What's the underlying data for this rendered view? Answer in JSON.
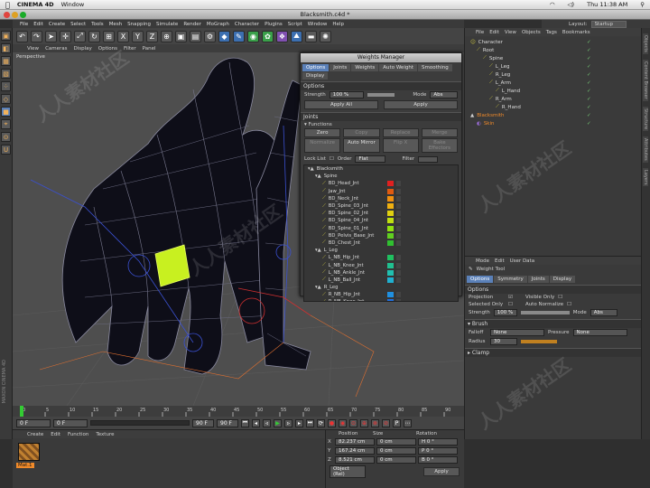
{
  "mac_menubar": {
    "app": "CINEMA 4D",
    "menu": "Window",
    "clock": "Thu 11:38 AM"
  },
  "window": {
    "title": "Blacksmith.c4d *"
  },
  "main_menu": [
    "File",
    "Edit",
    "Create",
    "Select",
    "Tools",
    "Mesh",
    "Snapping",
    "Simulate",
    "Render",
    "MoGraph",
    "Character",
    "Plugins",
    "Script",
    "Window",
    "Help"
  ],
  "layout": {
    "label": "Layout:",
    "value": "Startup"
  },
  "viewport": {
    "menu": [
      "View",
      "Cameras",
      "Display",
      "Options",
      "Filter",
      "Panel"
    ],
    "camera_label": "Perspective"
  },
  "weights_manager": {
    "title": "Weights Manager",
    "tabs": [
      "Options",
      "Joints",
      "Weights",
      "Auto Weight",
      "Smoothing",
      "Display"
    ],
    "options_label": "Options",
    "strength_label": "Strength",
    "strength_value": "100 %",
    "mode_label": "Mode",
    "mode_value": "Abs",
    "apply_all": "Apply All",
    "apply": "Apply",
    "joints_label": "Joints",
    "functions_label": "Functions",
    "function_buttons": [
      "Zero",
      "Copy",
      "Replace",
      "Merge",
      "Normalize",
      "Auto Mirror",
      "Flip X",
      "Bake Effectors"
    ],
    "locklist_label": "Lock List",
    "order_label": "Order",
    "order_value": "Flat",
    "filter_label": "Filter",
    "joints": [
      {
        "name": "Blacksmith",
        "indent": 0,
        "color": ""
      },
      {
        "name": "Spine",
        "indent": 1,
        "color": ""
      },
      {
        "name": "BD_Head_Jnt",
        "indent": 2,
        "color": "#e02020"
      },
      {
        "name": "Jaw_Jnt",
        "indent": 2,
        "color": "#e05a10"
      },
      {
        "name": "BD_Neck_Jnt",
        "indent": 2,
        "color": "#f09010"
      },
      {
        "name": "BD_Spine_03_Jnt",
        "indent": 2,
        "color": "#f0b010"
      },
      {
        "name": "BD_Spine_02_Jnt",
        "indent": 2,
        "color": "#e0d010"
      },
      {
        "name": "BD_Spine_04_Jnt",
        "indent": 2,
        "color": "#c0e010"
      },
      {
        "name": "BD_Spine_01_Jnt",
        "indent": 2,
        "color": "#90e010"
      },
      {
        "name": "BD_Pelvis_Base_Jnt",
        "indent": 2,
        "color": "#60d020"
      },
      {
        "name": "BD_Chest_Jnt",
        "indent": 2,
        "color": "#30c030"
      },
      {
        "name": "L_Leg",
        "indent": 1,
        "color": ""
      },
      {
        "name": "L_NB_Hip_Jnt",
        "indent": 2,
        "color": "#20c060"
      },
      {
        "name": "L_NB_Knee_Jnt",
        "indent": 2,
        "color": "#20c090"
      },
      {
        "name": "L_NB_Ankle_Jnt",
        "indent": 2,
        "color": "#20c0b0"
      },
      {
        "name": "L_NB_Ball_Jnt",
        "indent": 2,
        "color": "#20b0d0"
      },
      {
        "name": "R_Leg",
        "indent": 1,
        "color": ""
      },
      {
        "name": "R_NB_Hip_Jnt",
        "indent": 2,
        "color": "#2090e0"
      },
      {
        "name": "R_NB_Knee_Jnt",
        "indent": 2,
        "color": "#2070e0"
      }
    ]
  },
  "object_manager": {
    "menu": [
      "File",
      "Edit",
      "View",
      "Objects",
      "Tags",
      "Bookmarks"
    ],
    "objects": [
      {
        "name": "Character",
        "indent": 0,
        "selected": false
      },
      {
        "name": "Root",
        "indent": 1,
        "selected": false
      },
      {
        "name": "Spine",
        "indent": 2,
        "selected": false
      },
      {
        "name": "L_Leg",
        "indent": 3,
        "selected": false
      },
      {
        "name": "R_Leg",
        "indent": 3,
        "selected": false
      },
      {
        "name": "L_Arm",
        "indent": 3,
        "selected": false
      },
      {
        "name": "L_Hand",
        "indent": 4,
        "selected": false
      },
      {
        "name": "R_Arm",
        "indent": 3,
        "selected": false
      },
      {
        "name": "R_Hand",
        "indent": 4,
        "selected": false
      },
      {
        "name": "Blacksmith",
        "indent": 0,
        "selected": true
      },
      {
        "name": "Skin",
        "indent": 1,
        "selected": true
      }
    ]
  },
  "attribute_manager": {
    "menu": [
      "Mode",
      "Edit",
      "User Data"
    ],
    "tool_name": "Weight Tool",
    "tabs": [
      "Options",
      "Symmetry",
      "Joints",
      "Display"
    ],
    "options_label": "Options",
    "projection_label": "Projection",
    "visible_only_label": "Visible Only",
    "selected_only_label": "Selected Only",
    "auto_normalize_label": "Auto Normalize",
    "strength_label": "Strength",
    "strength_value": "100 %",
    "mode_label": "Mode",
    "mode_value": "Abs",
    "brush_label": "Brush",
    "falloff_label": "Falloff",
    "falloff_value": "None",
    "pressure_label": "Pressure",
    "pressure_value": "None",
    "radius_label": "Radius",
    "radius_value": "30",
    "clamp_label": "Clamp"
  },
  "timeline": {
    "ticks": [
      "0",
      "5",
      "10",
      "15",
      "20",
      "25",
      "30",
      "35",
      "40",
      "45",
      "50",
      "55",
      "60",
      "65",
      "70",
      "75",
      "80",
      "85",
      "90"
    ],
    "frame_start": "0 F",
    "frame_current": "0 F",
    "frame_end": "90 F",
    "frame_max": "90 F",
    "frame_right": "0 F"
  },
  "material_manager": {
    "menu": [
      "Create",
      "Edit",
      "Function",
      "Texture"
    ],
    "material_name": "Mat.1"
  },
  "coordinates": {
    "headers": [
      "Position",
      "Size",
      "Rotation"
    ],
    "rows": [
      {
        "axis": "X",
        "pos": "82.237 cm",
        "size": "0 cm",
        "rot": "H 0 °"
      },
      {
        "axis": "Y",
        "pos": "167.24 cm",
        "size": "0 cm",
        "rot": "P 0 °"
      },
      {
        "axis": "Z",
        "pos": "8.521 cm",
        "size": "0 cm",
        "rot": "B 0 °"
      }
    ],
    "object_select": "Object (Rel)",
    "apply": "Apply"
  },
  "left_strip_brand": "MAXON CINEMA 4D",
  "right_tabs": [
    "Objects",
    "Content Browser",
    "Structure",
    "Attributes",
    "Layers"
  ],
  "watermark": "人人素材社区",
  "colors": {
    "accent": "#5a80b8",
    "selected_object": "#f08a2a",
    "highlight_ring": "#c8f020"
  }
}
